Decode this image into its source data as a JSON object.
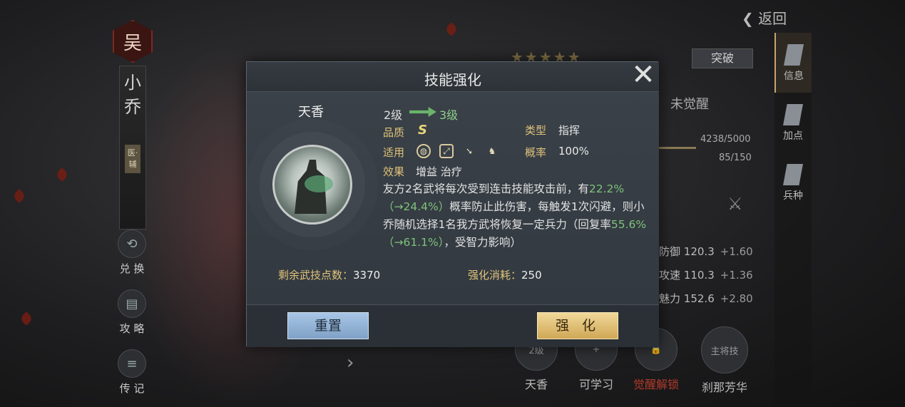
{
  "back_label": "返回",
  "hero": {
    "faction": "吴",
    "name_chars": [
      "小",
      "乔"
    ],
    "role_tag": "医·辅"
  },
  "left_nav": [
    {
      "label": "兑 换",
      "icon": "exchange-icon"
    },
    {
      "label": "攻 略",
      "icon": "guide-icon"
    },
    {
      "label": "传 记",
      "icon": "biography-icon"
    }
  ],
  "right_tabs": [
    {
      "label": "信息",
      "icon": "scroll-icon",
      "active": true
    },
    {
      "label": "加点",
      "icon": "armor-icon",
      "active": false
    },
    {
      "label": "兵种",
      "icon": "helmet-icon",
      "active": false
    }
  ],
  "panel": {
    "stars": "★★★★★",
    "breakthrough_label": "突破",
    "awaken_status": "未觉醒",
    "exp_text": "4238/5000",
    "troops_text": "85/150",
    "stats": [
      {
        "name": "防御",
        "value": "120.3",
        "inc": "+1.60"
      },
      {
        "name": "攻速",
        "value": "110.3",
        "inc": "+1.36"
      },
      {
        "name": "魅力",
        "value": "152.6",
        "inc": "+2.80"
      }
    ]
  },
  "skill_strip": [
    {
      "label": "天香",
      "badge": "2级"
    },
    {
      "label": "可学习",
      "badge": "+"
    },
    {
      "label": "觉醒解锁",
      "badge": ""
    },
    {
      "label": "刹那芳华",
      "badge": "主将技"
    }
  ],
  "dialog": {
    "title": "技能强化",
    "skill_name": "天香",
    "level_from": "2级",
    "level_to": "3级",
    "quality_label": "品质",
    "quality_value": "S",
    "type_label": "类型",
    "type_value": "指挥",
    "applicable_label": "适用",
    "applicable_icons": [
      "shield-icon",
      "bow-icon",
      "spear-icon",
      "horse-icon"
    ],
    "rate_label": "概率",
    "rate_value": "100%",
    "effect_label": "效果",
    "effect_value": "增益 治疗",
    "desc": {
      "p1": "友方2名武将每次受到连击技能攻击前，有",
      "g1": "22.2%（→24.4%）",
      "p2": "概率防止此伤害，每触发1次闪避，则小乔随机选择1名我方武将恢复一定兵力（回复率",
      "g2": "55.6%（→61.1%）",
      "p3": "，受智力影响）"
    },
    "remaining_label": "剩余武技点数：",
    "remaining_value": "3370",
    "cost_label": "强化消耗：",
    "cost_value": "250",
    "reset_label": "重置",
    "enhance_label": "强 化"
  },
  "colors": {
    "accent_gold": "#e0c27a",
    "highlight_green": "#7ec27a",
    "reset_blue": "#8fb2d6",
    "enhance_gold": "#dcb96a"
  }
}
